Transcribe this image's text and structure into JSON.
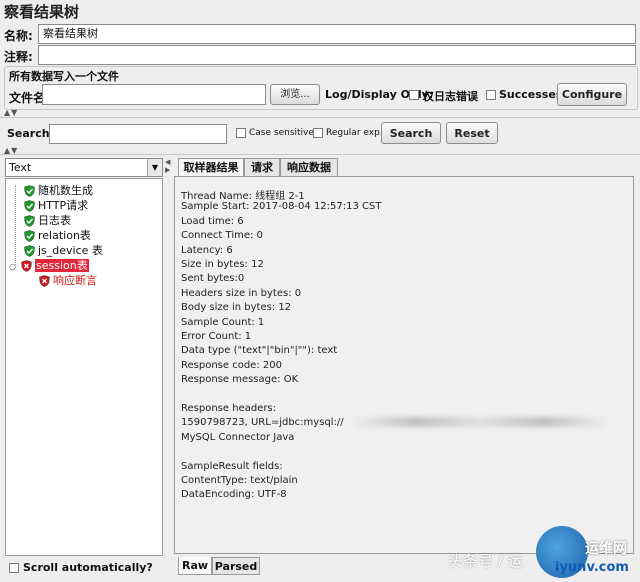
{
  "window": {
    "title": "察看结果树"
  },
  "form": {
    "name_label": "名称:",
    "name_value": "察看结果树",
    "comment_label": "注释:",
    "comment_value": ""
  },
  "file_section": {
    "heading": "所有数据写入一个文件",
    "filename_label": "文件名",
    "filename_value": "",
    "browse_label": "浏览...",
    "log_display_label": "Log/Display Only:",
    "errors_only_label": "仅日志错误",
    "successes_label": "Successes",
    "configure_label": "Configure"
  },
  "search": {
    "label": "Search:",
    "value": "",
    "case_sensitive_label": "Case sensitive",
    "regular_exp_label": "Regular exp.",
    "search_button": "Search",
    "reset_button": "Reset"
  },
  "renderer": {
    "selected": "Text"
  },
  "tree": {
    "items": [
      {
        "label": "随机数生成",
        "status": "success"
      },
      {
        "label": "HTTP请求",
        "status": "success"
      },
      {
        "label": "日志表",
        "status": "success"
      },
      {
        "label": "relation表",
        "status": "success"
      },
      {
        "label": "js_device 表",
        "status": "success"
      },
      {
        "label": "session表",
        "status": "error"
      }
    ],
    "child": {
      "label": "响应断言",
      "status": "error"
    }
  },
  "tabs": [
    "取样器结果",
    "请求",
    "响应数据"
  ],
  "result_lines": [
    "Thread Name: 线程组 2-1",
    "Sample Start: 2017-08-04 12:57:13 CST",
    "Load time: 6",
    "Connect Time: 0",
    "Latency: 6",
    "Size in bytes: 12",
    "Sent bytes:0",
    "Headers size in bytes: 0",
    "Body size in bytes: 12",
    "Sample Count: 1",
    "Error Count: 1",
    "Data type (\"text\"|\"bin\"|\"\"): text",
    "Response code: 200",
    "Response message: OK",
    "",
    "Response headers:",
    "1590798723, URL=jdbc:mysql://",
    "MySQL Connector Java",
    "",
    "SampleResult fields:",
    "ContentType: text/plain",
    "DataEncoding: UTF-8"
  ],
  "bottom_tabs": {
    "raw": "Raw",
    "parsed": "Parsed"
  },
  "scroll_auto_label": "Scroll automatically?",
  "watermark": {
    "left": "头条号 / 运",
    "site": "运维网",
    "url": "iyunv.com"
  },
  "colors": {
    "success_green": "#1e9a2c",
    "error_red": "#d01818",
    "selected_bg": "#e3263a"
  }
}
